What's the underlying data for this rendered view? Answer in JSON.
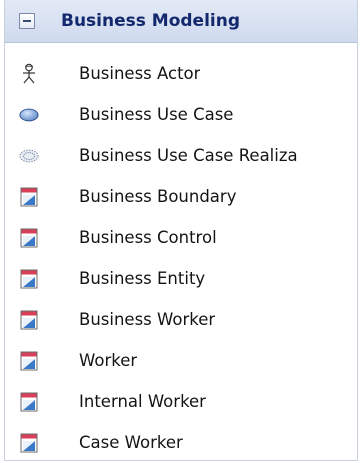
{
  "section": {
    "title": "Business Modeling",
    "items": [
      {
        "label": "Business Actor",
        "icon": "actor-icon"
      },
      {
        "label": "Business Use Case",
        "icon": "use-case-icon"
      },
      {
        "label": "Business Use Case Realiza",
        "icon": "use-case-realization-icon"
      },
      {
        "label": "Business Boundary",
        "icon": "class-element-icon"
      },
      {
        "label": "Business Control",
        "icon": "class-element-icon"
      },
      {
        "label": "Business Entity",
        "icon": "class-element-icon"
      },
      {
        "label": "Business Worker",
        "icon": "class-element-icon"
      },
      {
        "label": "Worker",
        "icon": "class-element-icon"
      },
      {
        "label": "Internal Worker",
        "icon": "class-element-icon"
      },
      {
        "label": "Case Worker",
        "icon": "class-element-icon"
      }
    ]
  },
  "colors": {
    "header_text": "#13286d",
    "header_bg": "#d8e1f1",
    "element_icon_red": "#d8405a",
    "element_icon_blue": "#3a78c8"
  }
}
